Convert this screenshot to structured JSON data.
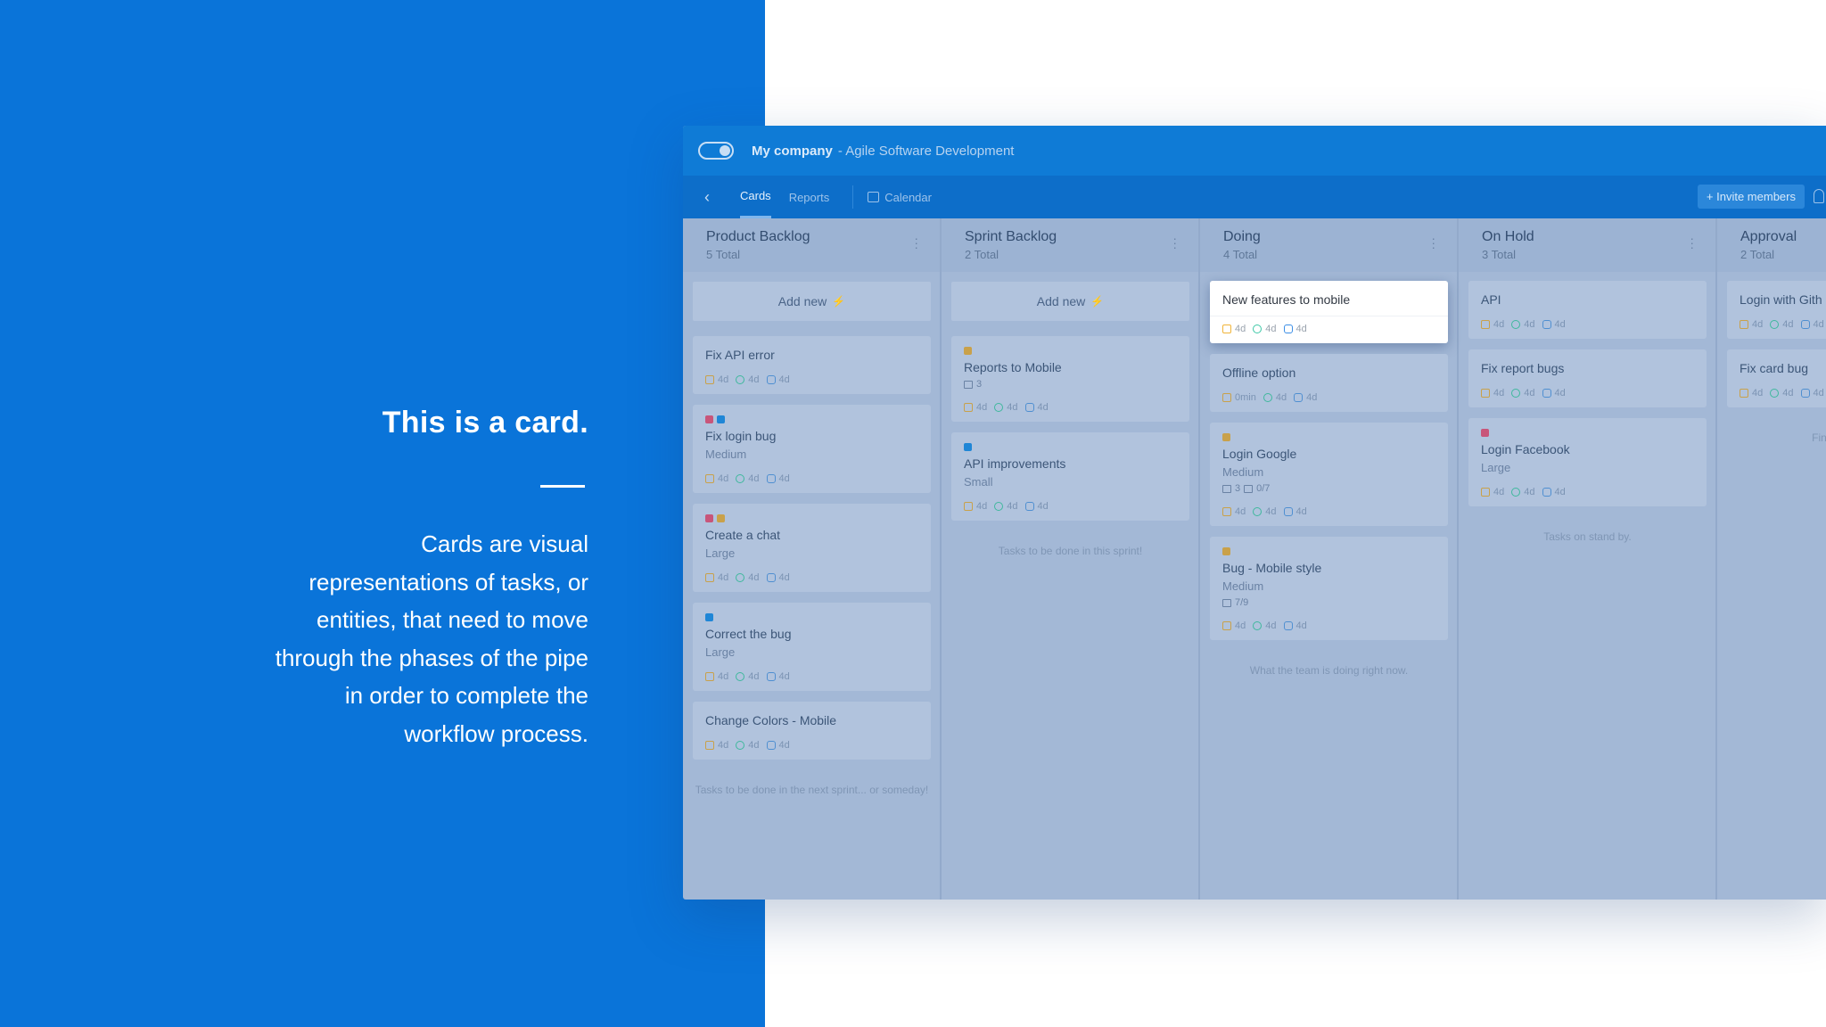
{
  "intro": {
    "title": "This is a card.",
    "lines": [
      "Cards are visual",
      "representations of tasks, or",
      "entities, that need to move",
      "through the phases of the pipe",
      "in order to complete the",
      "workflow process."
    ]
  },
  "app": {
    "company": "My company",
    "project": "- Agile Software Development",
    "back_icon": "chevron-left-icon",
    "tabs": {
      "cards": "Cards",
      "reports": "Reports",
      "calendar": "Calendar"
    },
    "invite_label": "+ Invite members"
  },
  "columns": [
    {
      "title": "Product Backlog",
      "total": "5 Total",
      "add_label": "Add new",
      "note": "Tasks to be done in the next sprint... or someday!",
      "cards": [
        {
          "title": "Fix API error",
          "size": "",
          "tags": [],
          "m": [
            "4d",
            "4d",
            "4d"
          ]
        },
        {
          "title": "Fix login bug",
          "size": "Medium",
          "tags": [
            "#c8557a",
            "#1f86d6"
          ],
          "m": [
            "4d",
            "4d",
            "4d"
          ]
        },
        {
          "title": "Create a chat",
          "size": "Large",
          "tags": [
            "#c8557a",
            "#c9a14a"
          ],
          "m": [
            "4d",
            "4d",
            "4d"
          ]
        },
        {
          "title": "Correct the bug",
          "size": "Large",
          "tags": [
            "#1f86d6"
          ],
          "m": [
            "4d",
            "4d",
            "4d"
          ]
        },
        {
          "title": "Change Colors - Mobile",
          "size": "",
          "tags": [],
          "m": [
            "4d",
            "4d",
            "4d"
          ]
        }
      ]
    },
    {
      "title": "Sprint Backlog",
      "total": "2 Total",
      "add_label": "Add new",
      "note": "Tasks to be done in this sprint!",
      "cards": [
        {
          "title": "Reports to Mobile",
          "size": "",
          "tags": [
            "#c9a14a"
          ],
          "extra": "3",
          "m": [
            "4d",
            "4d",
            "4d"
          ]
        },
        {
          "title": "API improvements",
          "size": "Small",
          "tags": [
            "#1f86d6"
          ],
          "m": [
            "4d",
            "4d",
            "4d"
          ]
        }
      ]
    },
    {
      "title": "Doing",
      "total": "4 Total",
      "note": "What the team is doing right now.",
      "cards": [
        {
          "title": "New features to mobile",
          "size": "",
          "tags": [],
          "active": true,
          "m": [
            "4d",
            "4d",
            "4d"
          ]
        },
        {
          "title": "Offline option",
          "size": "",
          "tags": [],
          "m": [
            "0min",
            "4d",
            "4d"
          ]
        },
        {
          "title": "Login Google",
          "size": "Medium",
          "tags": [
            "#c9a14a"
          ],
          "extra": "3",
          "extra2": "0/7",
          "m": [
            "4d",
            "4d",
            "4d"
          ]
        },
        {
          "title": "Bug - Mobile style",
          "size": "Medium",
          "tags": [
            "#c9a14a"
          ],
          "extra2": "7/9",
          "m": [
            "4d",
            "4d",
            "4d"
          ]
        }
      ]
    },
    {
      "title": "On Hold",
      "total": "3 Total",
      "note": "Tasks on stand by.",
      "cards": [
        {
          "title": "API",
          "size": "",
          "tags": [],
          "m": [
            "4d",
            "4d",
            "4d"
          ]
        },
        {
          "title": "Fix report bugs",
          "size": "",
          "tags": [],
          "m": [
            "4d",
            "4d",
            "4d"
          ]
        },
        {
          "title": "Login Facebook",
          "size": "Large",
          "tags": [
            "#c8557a"
          ],
          "m": [
            "4d",
            "4d",
            "4d"
          ]
        }
      ]
    },
    {
      "title": "Approval",
      "total": "2 Total",
      "note": "Finished tasks",
      "cards": [
        {
          "title": "Login with Gith",
          "size": "",
          "tags": [],
          "m": [
            "4d",
            "4d",
            "4d"
          ]
        },
        {
          "title": "Fix card bug",
          "size": "",
          "tags": [],
          "m": [
            "4d",
            "4d",
            "4d"
          ]
        }
      ]
    }
  ]
}
